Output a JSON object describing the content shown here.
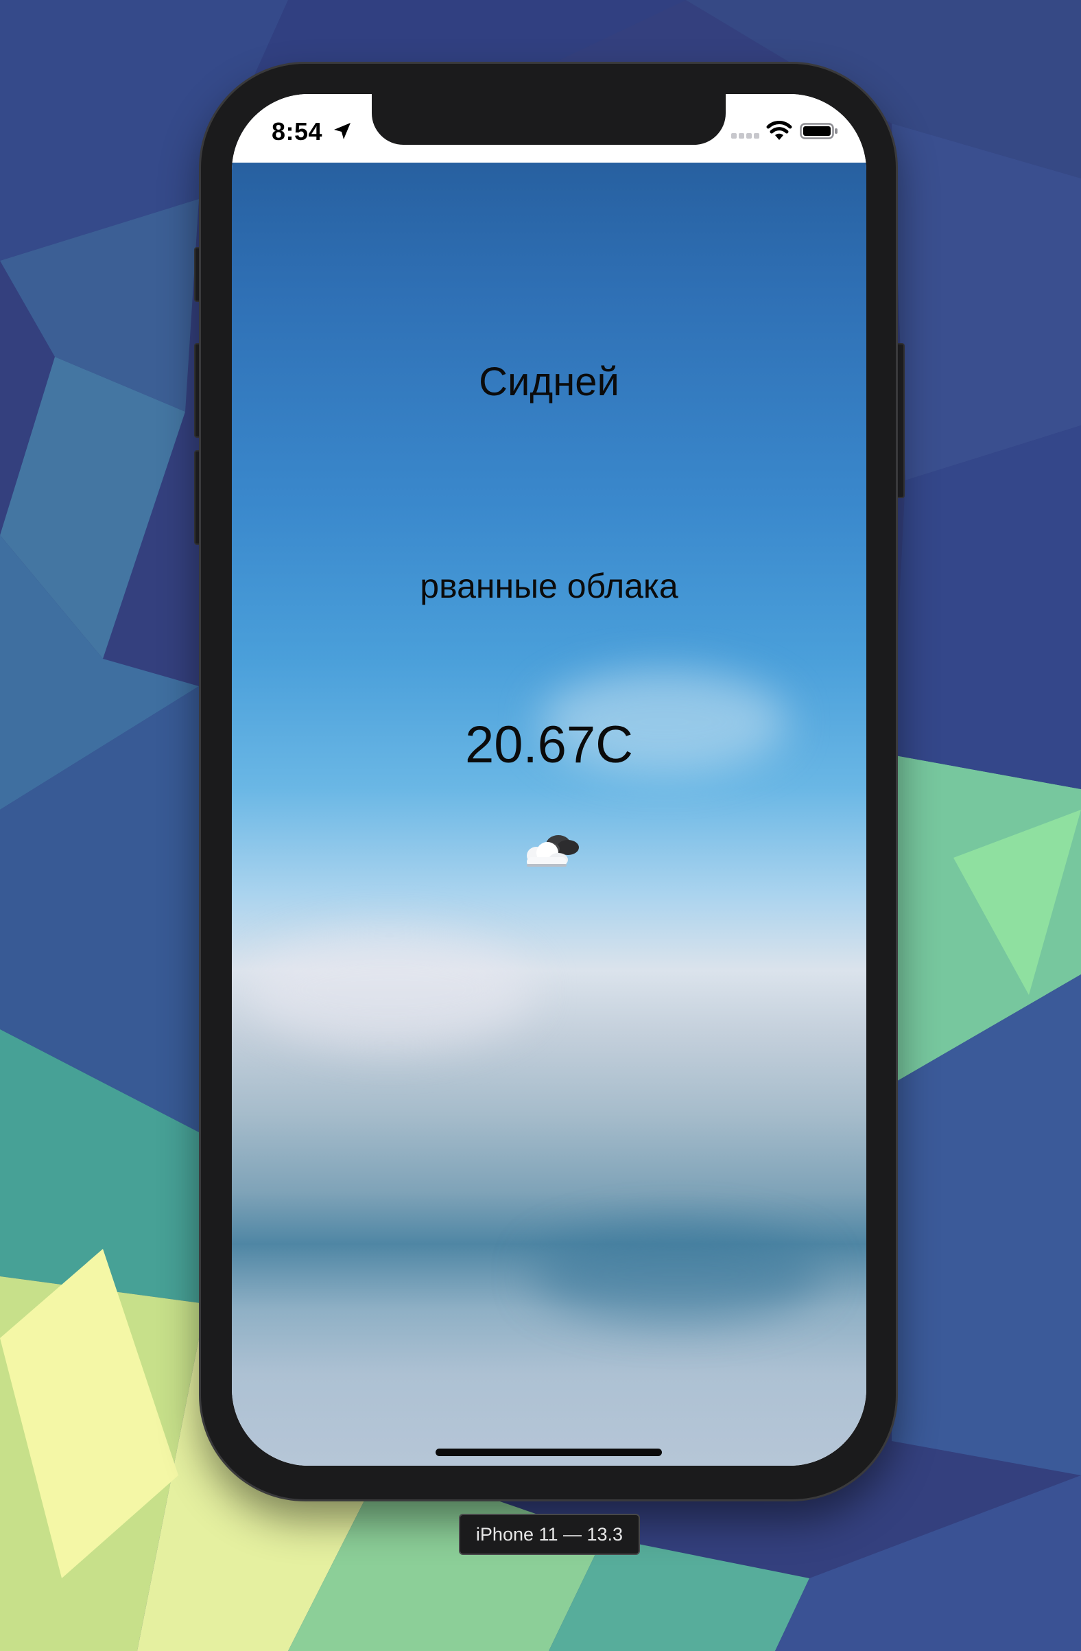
{
  "status_bar": {
    "time": "8:54"
  },
  "weather": {
    "city": "Сидней",
    "description": "рванные облака",
    "temperature": "20.67C",
    "icon": "cloud-with-dark-cloud-icon"
  },
  "simulator": {
    "device_label": "iPhone 11 — 13.3"
  }
}
